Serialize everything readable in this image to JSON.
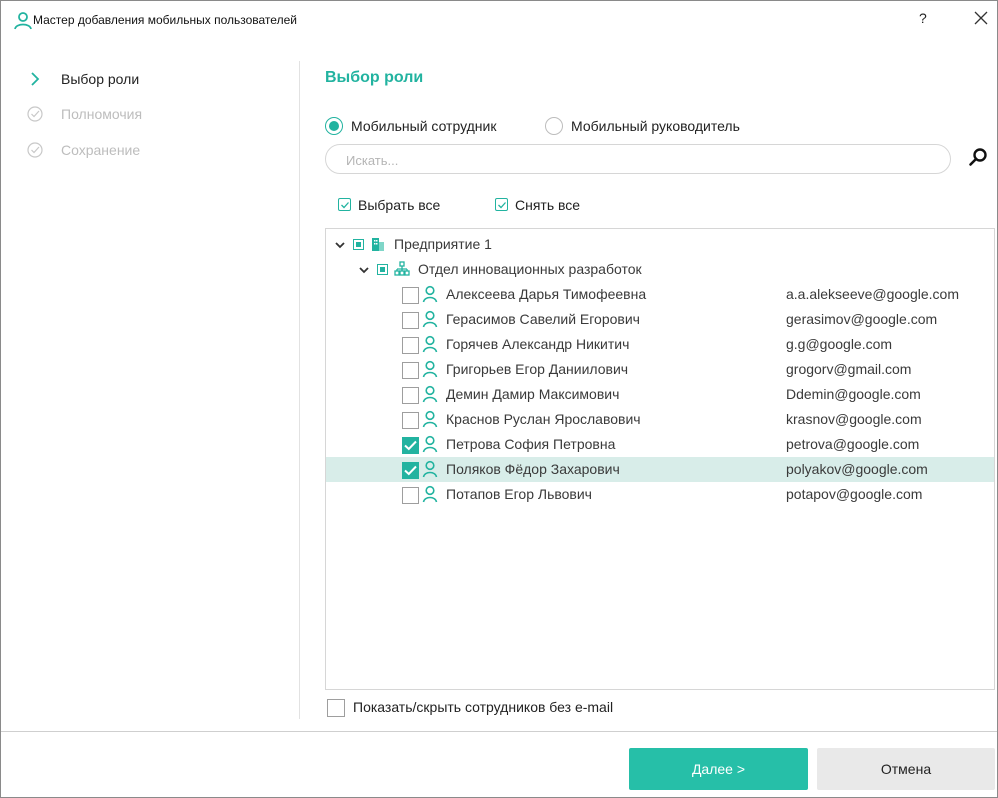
{
  "window": {
    "title": "Мастер добавления мобильных пользователей",
    "help_label": "?",
    "accent_color": "#22b3a0"
  },
  "nav": {
    "items": [
      {
        "label": "Выбор роли",
        "state": "active",
        "icon": "chevron-right-icon"
      },
      {
        "label": "Полномочия",
        "state": "disabled",
        "icon": "check-circle-icon"
      },
      {
        "label": "Сохранение",
        "state": "disabled",
        "icon": "check-circle-icon"
      }
    ]
  },
  "main": {
    "title": "Выбор роли",
    "roles": [
      {
        "label": "Мобильный сотрудник",
        "selected": true
      },
      {
        "label": "Мобильный руководитель",
        "selected": false
      }
    ],
    "search_placeholder": "Искать...",
    "select_all_label": "Выбрать все",
    "deselect_all_label": "Снять все",
    "tree": {
      "root": {
        "label": "Предприятие 1",
        "expanded": true
      },
      "department": {
        "label": "Отдел инновационных разработок",
        "expanded": true
      },
      "employees": [
        {
          "name": "Алексеева Дарья Тимофеевна",
          "email": "a.a.alekseeve@google.com",
          "checked": false,
          "highlighted": false
        },
        {
          "name": "Герасимов Савелий Егорович",
          "email": "gerasimov@google.com",
          "checked": false,
          "highlighted": false
        },
        {
          "name": "Горячев Александр Никитич",
          "email": "g.g@google.com",
          "checked": false,
          "highlighted": false
        },
        {
          "name": "Григорьев Егор Даниилович",
          "email": "grogorv@gmail.com",
          "checked": false,
          "highlighted": false
        },
        {
          "name": "Демин Дамир Максимович",
          "email": "Ddemin@google.com",
          "checked": false,
          "highlighted": false
        },
        {
          "name": "Краснов Руслан Ярославович",
          "email": "krasnov@google.com",
          "checked": false,
          "highlighted": false
        },
        {
          "name": "Петрова София Петровна",
          "email": "petrova@google.com",
          "checked": true,
          "highlighted": false
        },
        {
          "name": "Поляков Фёдор Захарович",
          "email": "polyakov@google.com",
          "checked": true,
          "highlighted": true
        },
        {
          "name": "Потапов Егор Львович",
          "email": "potapov@google.com",
          "checked": false,
          "highlighted": false
        }
      ]
    },
    "show_without_email_label": "Показать/скрыть сотрудников без e-mail",
    "show_without_email_checked": false
  },
  "footer": {
    "next_label": "Далее >",
    "cancel_label": "Отмена"
  }
}
